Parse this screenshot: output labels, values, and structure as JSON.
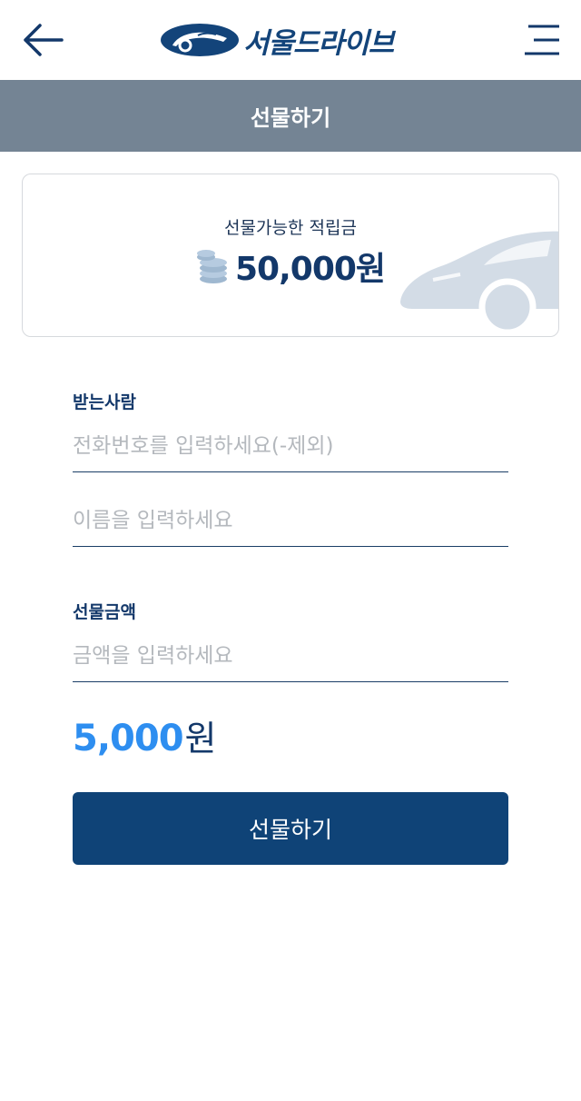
{
  "header": {
    "logo_text": "서울드라이브",
    "back_icon": "arrow-left-icon",
    "menu_icon": "hamburger-menu-icon"
  },
  "title_bar": {
    "title": "선물하기"
  },
  "points_card": {
    "label": "선물가능한 적립금",
    "amount": "50,000원"
  },
  "recipient": {
    "label": "받는사람",
    "phone_placeholder": "전화번호를 입력하세요(-제외)",
    "name_placeholder": "이름을 입력하세요"
  },
  "gift_amount": {
    "label": "선물금액",
    "placeholder": "금액을 입력하세요",
    "display_value": "5,000",
    "display_unit": "원"
  },
  "submit_button": {
    "label": "선물하기"
  },
  "colors": {
    "brand_navy": "#0f4377",
    "title_bar": "#748494",
    "accent_blue": "#2e8ef0"
  }
}
